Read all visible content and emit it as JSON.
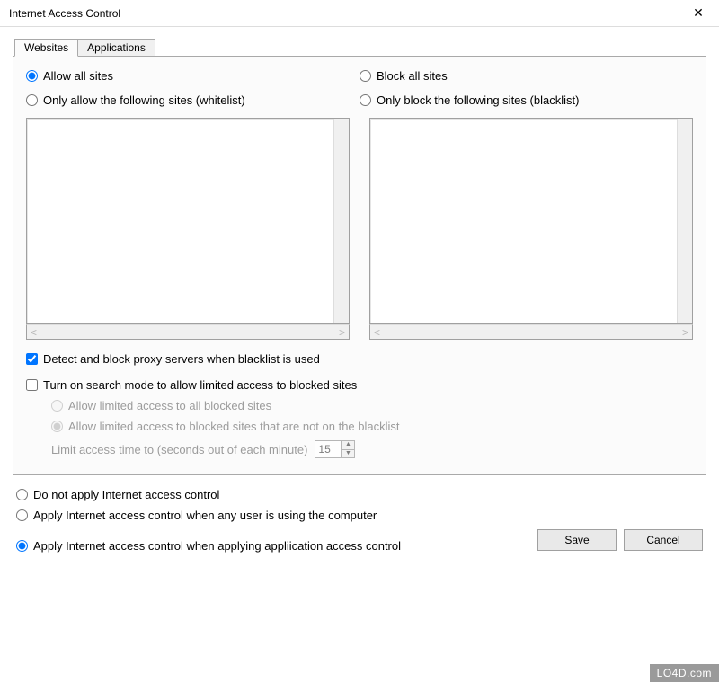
{
  "window": {
    "title": "Internet Access Control"
  },
  "tabs": {
    "websites": "Websites",
    "applications": "Applications"
  },
  "radios": {
    "allow_all": "Allow all sites",
    "whitelist": "Only allow the following sites (whitelist)",
    "block_all": "Block all sites",
    "blacklist": "Only block the following sites (blacklist)"
  },
  "checks": {
    "detect_proxy": "Detect and block proxy servers when blacklist is used",
    "search_mode": "Turn on search mode to allow limited access to blocked sites"
  },
  "limited": {
    "all_blocked": "Allow limited access to all blocked sites",
    "not_blacklist": "Allow limited access to blocked sites that are not on the blacklist",
    "limit_label": "Limit access time to (seconds out of each minute)",
    "limit_value": "15"
  },
  "apply": {
    "none": "Do not apply Internet access control",
    "any_user": "Apply Internet access control when any user is using the computer",
    "app_control": "Apply Internet access control when applying appliication access control"
  },
  "buttons": {
    "save": "Save",
    "cancel": "Cancel"
  },
  "watermark": "LO4D.com",
  "scroll": {
    "left": "<",
    "right": ">"
  }
}
